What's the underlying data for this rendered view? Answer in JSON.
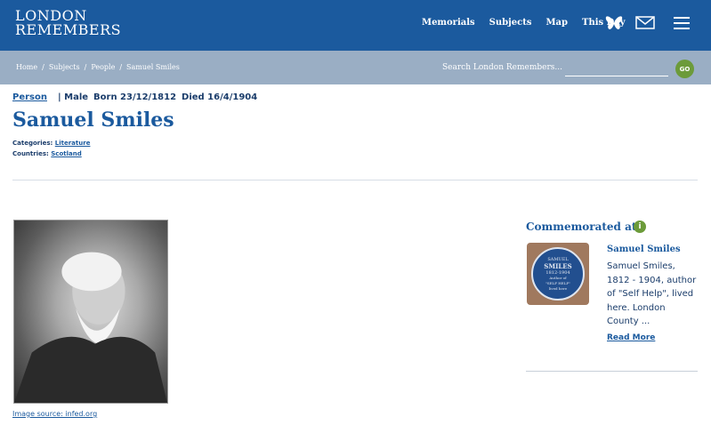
{
  "site": {
    "logo_line1": "LONDON",
    "logo_line2": "REMEMBERS"
  },
  "nav": {
    "items": [
      "Memorials",
      "Subjects",
      "Map",
      "This Day"
    ]
  },
  "icons": {
    "butterfly": "butterfly-icon",
    "mail": "envelope-icon",
    "menu": "hamburger-menu-icon",
    "info": "info-icon"
  },
  "breadcrumb": [
    "Home",
    "Subjects",
    "People",
    "Samuel Smiles"
  ],
  "search": {
    "label": "Search London Remembers...",
    "go_label": "GO"
  },
  "person": {
    "type": "Person",
    "sex": "| Male",
    "born": "Born 23/12/1812",
    "died": "Died 16/4/1904",
    "name": "Samuel Smiles",
    "categories_label": "Categories:",
    "category": "Literature",
    "countries_label": "Countries:",
    "country": "Scotland"
  },
  "image_source": "Image source: infed.org",
  "commemorated": {
    "title": "Commemorated at",
    "info_glyph": "i",
    "plaque_line1": "SAMUEL",
    "plaque_line2": "SMILES",
    "plaque_line3": "1812-1904",
    "plaque_line4": "Author of",
    "plaque_line5": "\"SELF HELP\"",
    "plaque_line6": "lived here",
    "card_title": "Samuel Smiles",
    "card_text": "Samuel Smiles, 1812 - 1904, author of \"Self Help\", lived here. London County ...",
    "read_more": "Read More"
  },
  "colors": {
    "header": "#1b5a9e",
    "subbar": "#9aaec4",
    "accent_green": "#6c9b3a",
    "link": "#1b5a9e"
  }
}
